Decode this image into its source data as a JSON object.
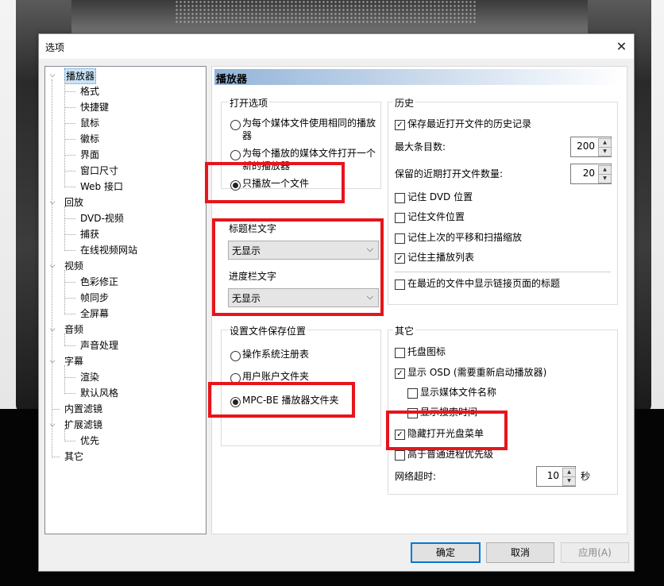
{
  "dialog": {
    "title": "选项",
    "close_glyph": "✕"
  },
  "tree": [
    {
      "label": "播放器",
      "level": 0,
      "expanded": true,
      "selected": true
    },
    {
      "label": "格式",
      "level": 1
    },
    {
      "label": "快捷键",
      "level": 1
    },
    {
      "label": "鼠标",
      "level": 1
    },
    {
      "label": "徽标",
      "level": 1
    },
    {
      "label": "界面",
      "level": 1
    },
    {
      "label": "窗口尺寸",
      "level": 1
    },
    {
      "label": "Web 接口",
      "level": 1
    },
    {
      "label": "回放",
      "level": 0,
      "expanded": true
    },
    {
      "label": "DVD-视频",
      "level": 1
    },
    {
      "label": "捕获",
      "level": 1
    },
    {
      "label": "在线视频网站",
      "level": 1
    },
    {
      "label": "视频",
      "level": 0,
      "expanded": true
    },
    {
      "label": "色彩修正",
      "level": 1
    },
    {
      "label": "帧同步",
      "level": 1
    },
    {
      "label": "全屏幕",
      "level": 1
    },
    {
      "label": "音频",
      "level": 0,
      "expanded": true
    },
    {
      "label": "声音处理",
      "level": 1
    },
    {
      "label": "字幕",
      "level": 0,
      "expanded": true
    },
    {
      "label": "渲染",
      "level": 1
    },
    {
      "label": "默认风格",
      "level": 1
    },
    {
      "label": "内置滤镜",
      "level": 0
    },
    {
      "label": "扩展滤镜",
      "level": 0,
      "expanded": true
    },
    {
      "label": "优先",
      "level": 1
    },
    {
      "label": "其它",
      "level": 0
    }
  ],
  "panel": {
    "header": "播放器",
    "open_options": {
      "title": "打开选项",
      "opt1_line1": "为每个媒体文件使用相同的播放",
      "opt1_line2": "器",
      "opt2_line1": "为每个播放的媒体文件打开一个",
      "opt2_line2": "新的播放器",
      "opt3": "只播放一个文件",
      "selected": "opt3"
    },
    "title_bar_text": {
      "label": "标题栏文字",
      "value": "无显示"
    },
    "progress_bar_text": {
      "label": "进度栏文字",
      "value": "无显示"
    },
    "save_location": {
      "title": "设置文件保存位置",
      "opt1": "操作系统注册表",
      "opt2": "用户账户文件夹",
      "opt3": "MPC-BE 播放器文件夹",
      "selected": "opt3"
    },
    "history": {
      "title": "历史",
      "keep_history": {
        "label": "保存最近打开文件的历史记录",
        "checked": true
      },
      "max_entries_label": "最大条目数:",
      "max_entries_value": "200",
      "recent_count_label": "保留的近期打开文件数量:",
      "recent_count_value": "20",
      "remember_dvd": {
        "label": "记住 DVD 位置",
        "checked": false
      },
      "remember_file": {
        "label": "记住文件位置",
        "checked": false
      },
      "remember_pan": {
        "label": "记住上次的平移和扫描缩放",
        "checked": false
      },
      "remember_playlist": {
        "label": "记住主播放列表",
        "checked": true
      },
      "show_link_title": {
        "label": "在最近的文件中显示链接页面的标题",
        "checked": false
      }
    },
    "other": {
      "title": "其它",
      "tray_icon": {
        "label": "托盘图标",
        "checked": false
      },
      "show_osd": {
        "label": "显示 OSD (需要重新启动播放器)",
        "checked": true
      },
      "show_media_name": {
        "label": "显示媒体文件名称",
        "checked": false
      },
      "show_seek_time": {
        "label": "显示搜索时间",
        "checked": false
      },
      "hide_disc_menu": {
        "label": "隐藏打开光盘菜单",
        "checked": true
      },
      "high_priority": {
        "label": "高于普通进程优先级",
        "checked": false
      },
      "network_timeout_label": "网络超时:",
      "network_timeout_value": "10",
      "network_timeout_unit": "秒"
    }
  },
  "buttons": {
    "ok": "确定",
    "cancel": "取消",
    "apply": "应用(A)"
  },
  "annotation_color": "#e8141b"
}
